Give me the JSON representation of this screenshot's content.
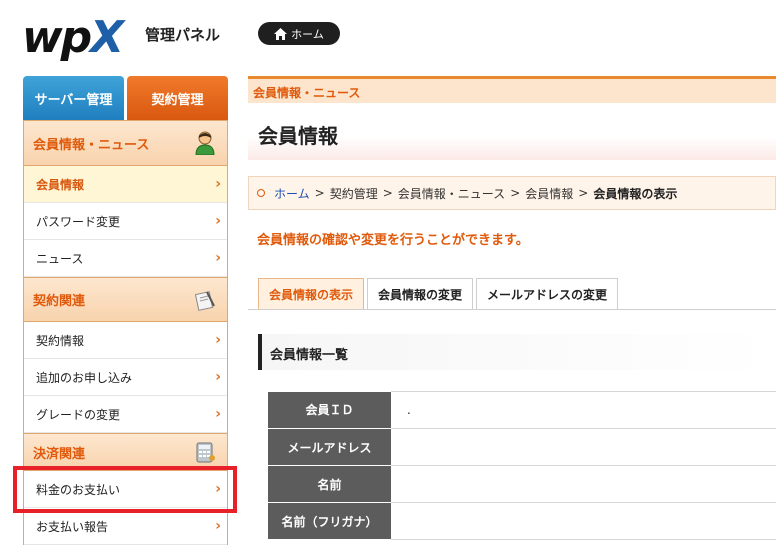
{
  "header": {
    "logo_text": "wpX",
    "logo_subtitle": "管理パネル",
    "home_button": "ホーム"
  },
  "sidebar": {
    "tabs": [
      "サーバー管理",
      "契約管理"
    ],
    "sections": [
      {
        "title": "会員情報・ニュース",
        "icon": "member-icon",
        "items": [
          "会員情報",
          "パスワード変更",
          "ニュース"
        ]
      },
      {
        "title": "契約関連",
        "icon": "contract-document-icon",
        "items": [
          "契約情報",
          "追加のお申し込み",
          "グレードの変更"
        ]
      },
      {
        "title": "決済関連",
        "icon": "calculator-icon",
        "items": [
          "料金のお支払い",
          "お支払い報告"
        ]
      }
    ],
    "active_item": "会員情報",
    "highlighted_item": "料金のお支払い"
  },
  "main": {
    "section_header": "会員情報・ニュース",
    "page_title": "会員情報",
    "breadcrumb": [
      "ホーム",
      "契約管理",
      "会員情報・ニュース",
      "会員情報",
      "会員情報の表示"
    ],
    "breadcrumb_separator": ">",
    "lead_text": "会員情報の確認や変更を行うことができます。",
    "content_tabs": [
      "会員情報の表示",
      "会員情報の変更",
      "メールアドレスの変更"
    ],
    "active_tab": "会員情報の表示",
    "list_title": "会員情報一覧",
    "table": [
      {
        "label": "会員ＩＤ",
        "value": "."
      },
      {
        "label": "メールアドレス",
        "value": ""
      },
      {
        "label": "名前",
        "value": ""
      },
      {
        "label": "名前（フリガナ）",
        "value": ""
      }
    ]
  },
  "colors": {
    "accent_orange": "#e05a0c",
    "server_tab_blue": "#1f7fbf",
    "highlight_red": "#e8202a",
    "table_header_gray": "#5c5c5c"
  }
}
